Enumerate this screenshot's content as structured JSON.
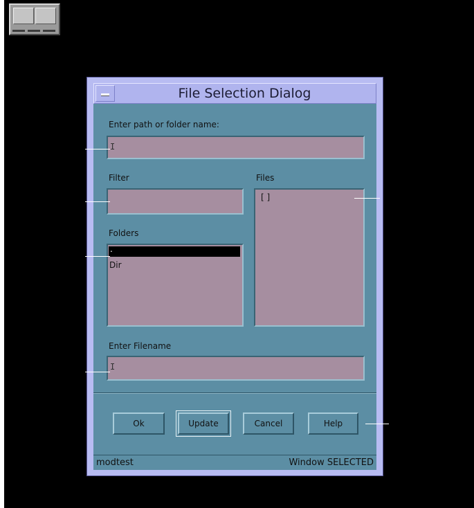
{
  "window": {
    "title": "File Selection Dialog"
  },
  "path": {
    "label": "Enter path or folder name:",
    "value": ""
  },
  "filter": {
    "label": "Filter",
    "value": ""
  },
  "files": {
    "label": "Files",
    "items": [
      "[ ]"
    ]
  },
  "folders": {
    "label": "Folders",
    "items": [
      ".",
      "Dir"
    ],
    "selected_index": 0
  },
  "filename": {
    "label": "Enter Filename",
    "value": ""
  },
  "buttons": {
    "ok": "Ok",
    "update": "Update",
    "cancel": "Cancel",
    "help": "Help"
  },
  "status": {
    "left": "modtest",
    "right": "Window SELECTED"
  },
  "colors": {
    "client": "#5c8ea4",
    "field": "#a68ea0",
    "frame": "#b8bcf2",
    "desktop": "#000000"
  }
}
